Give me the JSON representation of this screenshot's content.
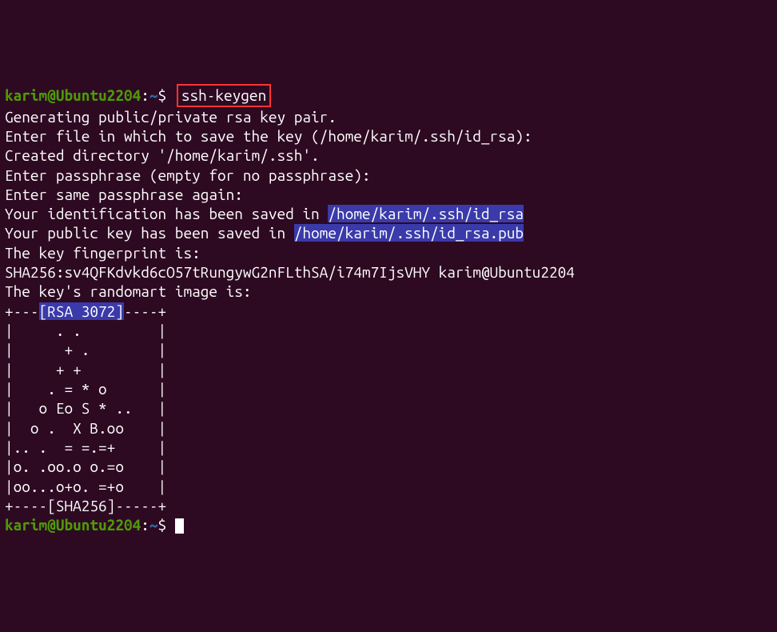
{
  "prompt": {
    "user": "karim",
    "at": "@",
    "host": "Ubuntu2204",
    "colon": ":",
    "path": "~",
    "dollar": "$"
  },
  "command": "ssh-keygen",
  "output": {
    "line1": "Generating public/private rsa key pair.",
    "line2": "Enter file in which to save the key (/home/karim/.ssh/id_rsa):",
    "line3": "Created directory '/home/karim/.ssh'.",
    "line4": "Enter passphrase (empty for no passphrase):",
    "line5": "Enter same passphrase again:",
    "line6_prefix": "Your identification has been saved in ",
    "line6_path": "/home/karim/.ssh/id_rsa",
    "line7_prefix": "Your public key has been saved in ",
    "line7_path": "/home/karim/.ssh/id_rsa.pub",
    "line8": "The key fingerprint is:",
    "line9": "SHA256:sv4QFKdvkd6cO57tRungywG2nFLthSA/i74m7IjsVHY karim@Ubuntu2204",
    "line10": "The key's randomart image is:",
    "randomart": {
      "top_prefix": "+---",
      "top_label": "[RSA 3072]",
      "top_suffix": "----+",
      "r1": "|     . .         |",
      "r2": "|      + .        |",
      "r3": "|     + +         |",
      "r4": "|    . = * o      |",
      "r5": "|   o Eo S * ..   |",
      "r6": "|  o .  X B.oo    |",
      "r7": "|.. .  = =.=+     |",
      "r8": "|o. .oo.o o.=o    |",
      "r9": "|oo...o+o. =+o    |",
      "bottom": "+----[SHA256]-----+"
    }
  }
}
